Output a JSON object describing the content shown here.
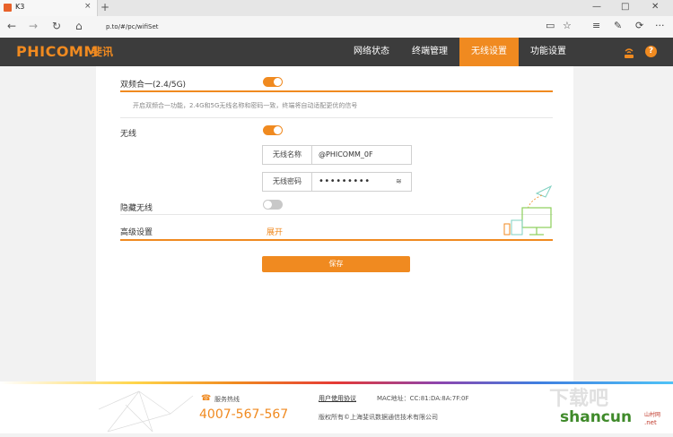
{
  "browser": {
    "tab_title": "K3",
    "tab_close": "×",
    "new_tab": "+",
    "url": "p.to/#/pc/wifiSet",
    "win_min": "—",
    "win_max": "□",
    "win_close": "✕",
    "back": "←",
    "forward": "→",
    "refresh": "↻",
    "home": "⌂",
    "reading_view": "▭",
    "favorite": "☆",
    "hub": "≡",
    "note": "✎",
    "share": "⟳",
    "more": "···"
  },
  "header": {
    "logo": "PHICOMM",
    "logo_cn": "斐讯",
    "nav": [
      "网络状态",
      "终端管理",
      "无线设置",
      "功能设置"
    ],
    "active_index": 2
  },
  "settings": {
    "dual_band_label": "双频合一(2.4/5G)",
    "dual_band_on": true,
    "dual_band_hint": "开启双频合一功能，2.4G和5G无线名称和密码一致，终端将自动适配更优的信号",
    "wireless_label": "无线",
    "wireless_on": true,
    "ssid_label": "无线名称",
    "ssid_value": "@PHICOMM_0F",
    "password_label": "无线密码",
    "password_value": "•••••••••",
    "hidden_label": "隐藏无线",
    "hidden_on": false,
    "advanced_label": "高级设置",
    "advanced_toggle": "展开",
    "save_label": "保存"
  },
  "footer": {
    "hotline_label": "服务热线",
    "hotline": "4007-567-567",
    "agreement": "用户使用协议",
    "mac_label": "MAC地址：CC:81:DA:8A:7F:0F",
    "copyright": "版权所有©上海斐讯数据通信技术有限公司"
  },
  "watermark": {
    "text": "shancun",
    "sub": "山村网",
    "tld": ".net"
  },
  "colors": {
    "accent": "#f08a20",
    "header_bg": "#3c3c3c"
  }
}
